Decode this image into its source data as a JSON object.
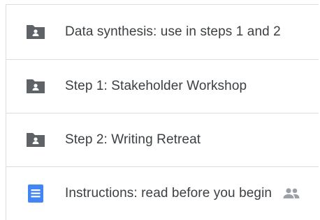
{
  "files": [
    {
      "name": "Data synthesis: use in steps 1 and 2",
      "type_icon": "shared-folder-icon",
      "shared": false
    },
    {
      "name": "Step 1: Stakeholder Workshop",
      "type_icon": "shared-folder-icon",
      "shared": false
    },
    {
      "name": "Step 2: Writing Retreat",
      "type_icon": "shared-folder-icon",
      "shared": false
    },
    {
      "name": "Instructions: read before you begin",
      "type_icon": "google-doc-icon",
      "shared": true,
      "shared_icon": "people-icon"
    }
  ],
  "colors": {
    "folder": "#5f6368",
    "doc": "#4285f4",
    "text": "#3c4043",
    "divider": "#dadce0",
    "shared": "#9aa0a6"
  }
}
